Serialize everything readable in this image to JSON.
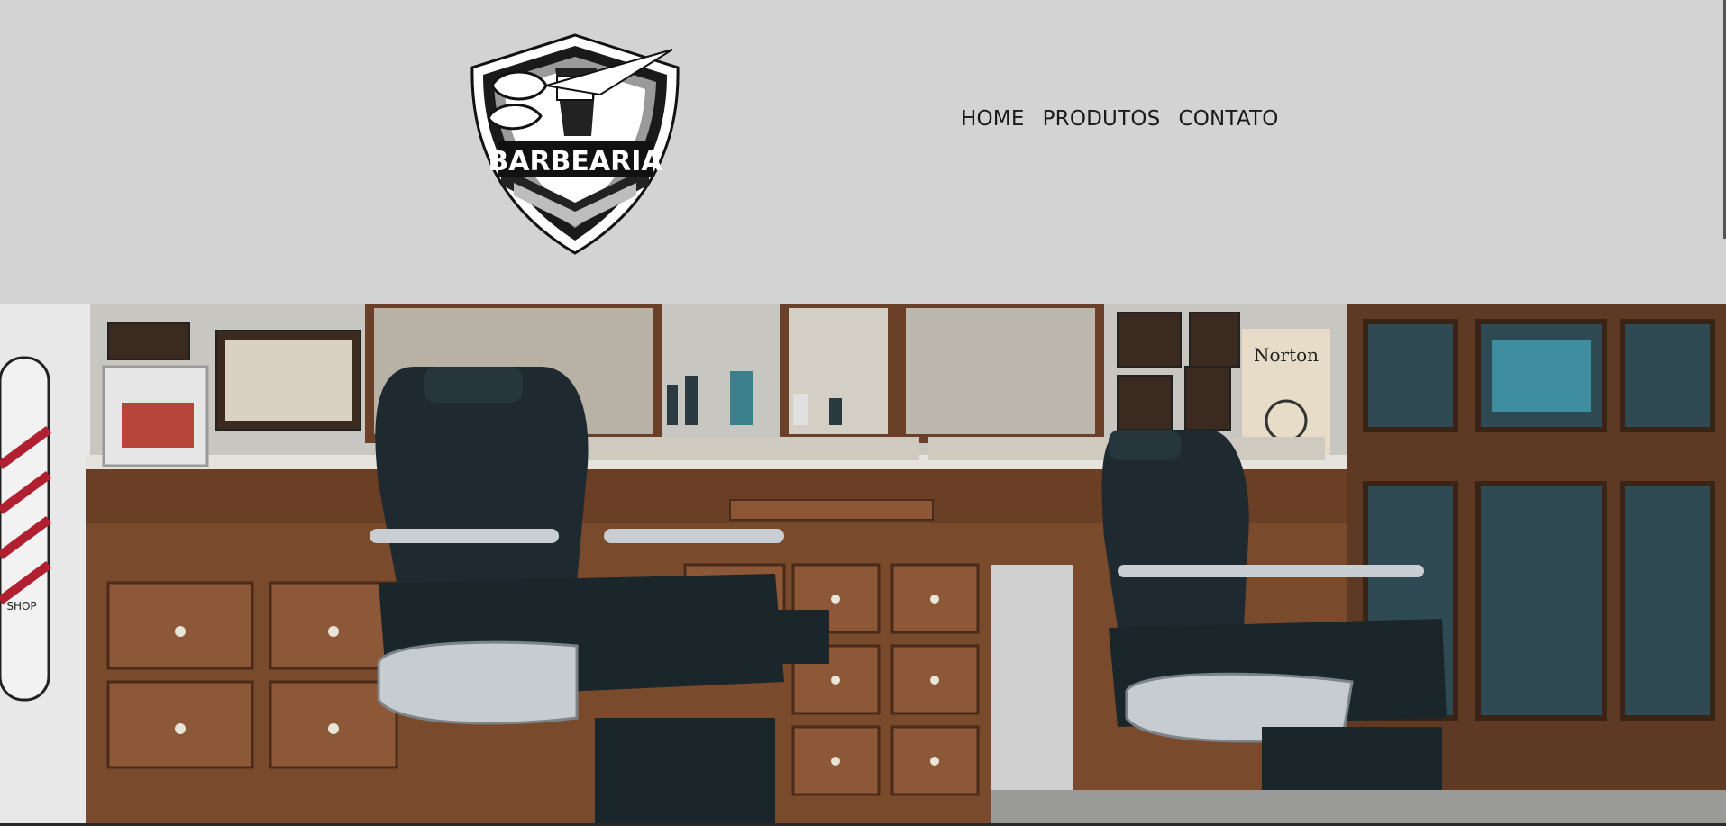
{
  "brand": {
    "logo_text": "BARBEARIA",
    "logo_icon": "scissors-fist-shield-icon"
  },
  "nav": {
    "items": [
      {
        "label": "HOME"
      },
      {
        "label": "PRODUTOS"
      },
      {
        "label": "CONTATO"
      }
    ]
  },
  "hero": {
    "image_subject": "barbershop interior with barber chairs, wooden cabinets and framed pictures",
    "poster_text": "Norton",
    "pole_text": "SHOP"
  },
  "colors": {
    "header_bg": "#d3d3d3",
    "nav_text": "#1a1a1a",
    "wood": "#7a4a2c",
    "leather": "#1e2a30"
  }
}
